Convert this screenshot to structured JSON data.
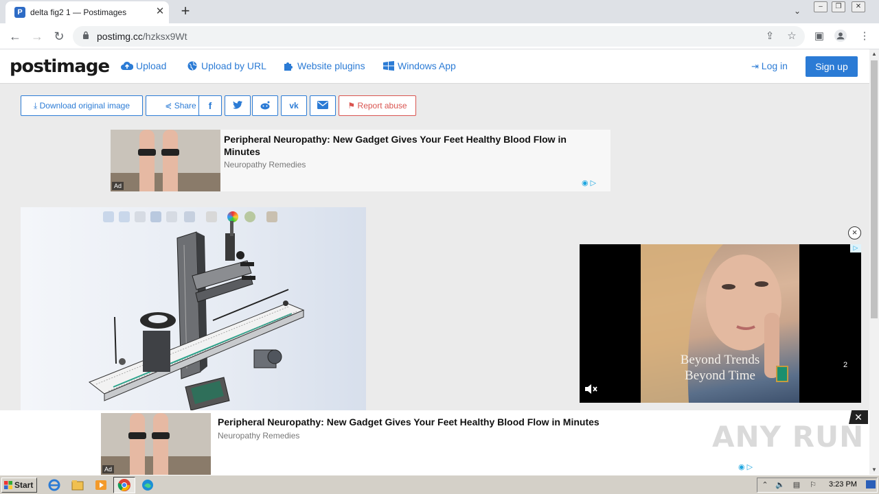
{
  "browser": {
    "tab_title": "delta fig2 1 — Postimages",
    "tab_close": "✕",
    "new_tab": "+",
    "url_host": "postimg.cc",
    "url_path": "/hzksx9Wt"
  },
  "site": {
    "logo": "postimage",
    "nav": [
      {
        "label": "Upload",
        "icon": "cloud-upload-icon"
      },
      {
        "label": "Upload by URL",
        "icon": "globe-icon"
      },
      {
        "label": "Website plugins",
        "icon": "puzzle-icon"
      },
      {
        "label": "Windows App",
        "icon": "windows-icon"
      }
    ],
    "login": "Log in",
    "signup": "Sign up"
  },
  "actions": {
    "download": "Download original image",
    "share": "Share",
    "report": "Report abuse"
  },
  "top_ad": {
    "title": "Peripheral Neuropathy: New Gadget Gives Your Feet Healthy Blood Flow in Minutes",
    "source": "Neuropathy Remedies",
    "tag": "Ad"
  },
  "video_ad": {
    "line1": "Beyond Trends",
    "line2": "Beyond Time",
    "count": "2",
    "close": "×"
  },
  "bottom_ad": {
    "title": "Peripheral Neuropathy: New Gadget Gives Your Feet Healthy Blood Flow in Minutes",
    "source": "Neuropathy Remedies",
    "tag": "Ad",
    "close": "✕"
  },
  "watermark": "ANY RUN",
  "taskbar": {
    "start": "Start",
    "clock": "3:23 PM"
  },
  "colors": {
    "accent": "#2b7bd5",
    "report": "#d9534f",
    "page_bg": "#ebebeb"
  }
}
